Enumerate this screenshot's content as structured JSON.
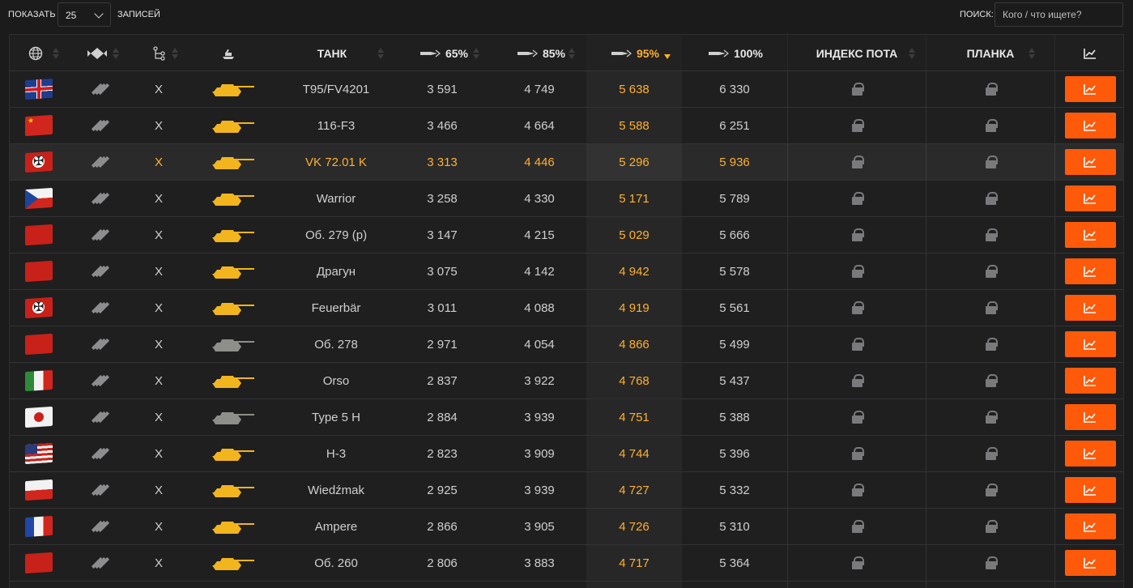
{
  "controls": {
    "show_label": "ПОКАЗАТЬ",
    "page_size": "25",
    "entries_label": "ЗАПИСЕЙ",
    "search_label": "ПОИСК:",
    "search_placeholder": "Кого / что ищете?"
  },
  "columns": {
    "nation_icon": "globe-icon",
    "class_icon": "tank-class-icon",
    "tier_icon": "tech-tree-icon",
    "type_icon": "tank-silhouette-icon",
    "tank": "ТАНК",
    "p65": "65%",
    "p85": "85%",
    "p95": "95%",
    "p100": "100%",
    "index": "ИНДЕКС ПОТА",
    "bar": "ПЛАНКА",
    "chart_icon": "chart-icon"
  },
  "sorted_column": "95%",
  "colors": {
    "accent": "#ffb02e",
    "button": "#ff5a0a"
  },
  "rows": [
    {
      "flag": "uk",
      "tier": "X",
      "tank": "T95/FV4201",
      "p65": "3 591",
      "p85": "4 749",
      "p95": "5 638",
      "p100": "6 330"
    },
    {
      "flag": "cn",
      "tier": "X",
      "tank": "116-F3",
      "p65": "3 466",
      "p85": "4 664",
      "p95": "5 588",
      "p100": "6 251"
    },
    {
      "flag": "de",
      "tier": "X",
      "tank": "VK 72.01 K",
      "p65": "3 313",
      "p85": "4 446",
      "p95": "5 296",
      "p100": "5 936",
      "highlight": true
    },
    {
      "flag": "cz",
      "tier": "X",
      "tank": "Warrior",
      "p65": "3 258",
      "p85": "4 330",
      "p95": "5 171",
      "p100": "5 789"
    },
    {
      "flag": "su",
      "tier": "X",
      "tank": "Об. 279 (р)",
      "p65": "3 147",
      "p85": "4 215",
      "p95": "5 029",
      "p100": "5 666"
    },
    {
      "flag": "su",
      "tier": "X",
      "tank": "Драгун",
      "p65": "3 075",
      "p85": "4 142",
      "p95": "4 942",
      "p100": "5 578"
    },
    {
      "flag": "de",
      "tier": "X",
      "tank": "Feuerbär",
      "p65": "3 011",
      "p85": "4 088",
      "p95": "4 919",
      "p100": "5 561"
    },
    {
      "flag": "su",
      "tier": "X",
      "tank": "Об. 278",
      "p65": "2 971",
      "p85": "4 054",
      "p95": "4 866",
      "p100": "5 499",
      "grey": true
    },
    {
      "flag": "it",
      "tier": "X",
      "tank": "Orso",
      "p65": "2 837",
      "p85": "3 922",
      "p95": "4 768",
      "p100": "5 437"
    },
    {
      "flag": "jp",
      "tier": "X",
      "tank": "Type 5 H",
      "p65": "2 884",
      "p85": "3 939",
      "p95": "4 751",
      "p100": "5 388",
      "grey": true
    },
    {
      "flag": "us",
      "tier": "X",
      "tank": "H-3",
      "p65": "2 823",
      "p85": "3 909",
      "p95": "4 744",
      "p100": "5 396"
    },
    {
      "flag": "pl",
      "tier": "X",
      "tank": "Wiedźmak",
      "p65": "2 925",
      "p85": "3 939",
      "p95": "4 727",
      "p100": "5 332"
    },
    {
      "flag": "fr",
      "tier": "X",
      "tank": "Ampere",
      "p65": "2 866",
      "p85": "3 905",
      "p95": "4 726",
      "p100": "5 310"
    },
    {
      "flag": "su",
      "tier": "X",
      "tank": "Об. 260",
      "p65": "2 806",
      "p85": "3 883",
      "p95": "4 717",
      "p100": "5 364"
    }
  ]
}
